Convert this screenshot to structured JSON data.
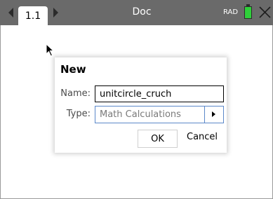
{
  "topbar": {
    "tab_label": "1.1",
    "doc_title": "Doc",
    "angle_mode": "RAD",
    "battery_color": "#2fcf3a"
  },
  "dialog": {
    "title": "New",
    "name_label": "Name:",
    "name_value": "unitcircle_cruch",
    "type_label": "Type:",
    "type_value": "Math Calculations",
    "ok_label": "OK",
    "cancel_label": "Cancel"
  },
  "icons": [
    "left-arrow-icon",
    "right-arrow-icon",
    "battery-icon",
    "close-icon",
    "cursor-icon",
    "dropdown-arrow-icon"
  ]
}
